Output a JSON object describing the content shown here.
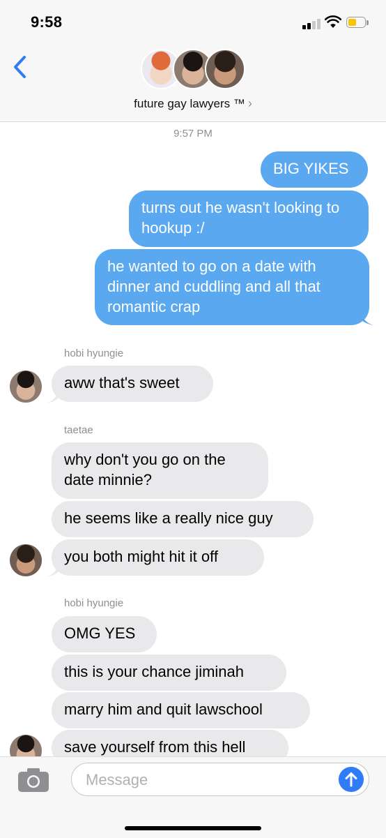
{
  "status_bar": {
    "time": "9:58"
  },
  "header": {
    "group_name": "future gay lawyers ™",
    "chevron": "›",
    "back_icon": "chevron-left-icon"
  },
  "conversation": {
    "timestamp": "9:57 PM",
    "outgoing": [
      "BIG YIKES",
      "turns out he wasn't looking to hookup :/",
      "he wanted to go on a date with dinner and cuddling and all that romantic crap"
    ],
    "groups": [
      {
        "sender": "hobi hyungie",
        "messages": [
          "aww that's sweet"
        ]
      },
      {
        "sender": "taetae",
        "messages": [
          "why don't you go on the date minnie?",
          "he seems like a really nice guy",
          "you both might hit it off"
        ]
      },
      {
        "sender": "hobi hyungie",
        "messages": [
          "OMG YES",
          "this is your chance jiminah",
          "marry him and quit lawschool",
          "save yourself from this hell"
        ]
      }
    ]
  },
  "composer": {
    "placeholder": "Message",
    "camera_icon": "camera-icon",
    "send_icon": "arrow-up-icon"
  },
  "colors": {
    "outgoing_bubble": "#5aa8f0",
    "incoming_bubble": "#e9e9eb",
    "accent": "#2f7cf6"
  }
}
